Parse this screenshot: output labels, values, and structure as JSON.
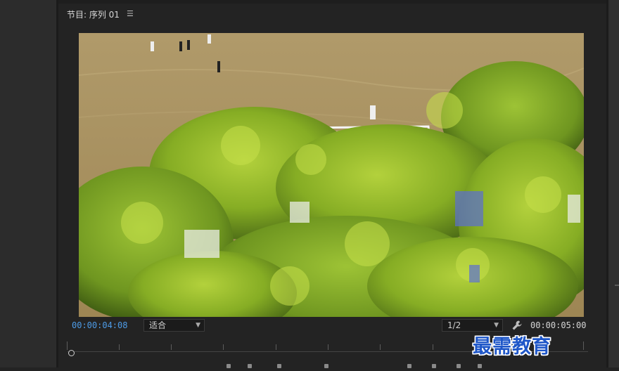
{
  "panel": {
    "title": "节目: 序列 01",
    "menu_icon": "hamburger-icon"
  },
  "viewer": {
    "content": "video-frame"
  },
  "controls": {
    "current_timecode": "00:00:04:08",
    "zoom_select": {
      "value": "适合",
      "chevron": "chevron-down-icon"
    },
    "resolution_select": {
      "value": "1/2",
      "chevron": "chevron-down-icon"
    },
    "settings_icon": "wrench-icon",
    "duration_timecode": "00:00:05:00"
  },
  "watermark": "最需教育",
  "colors": {
    "accent_timecode": "#4d9be6",
    "watermark": "#1e56c8",
    "panel_bg": "#232323"
  }
}
